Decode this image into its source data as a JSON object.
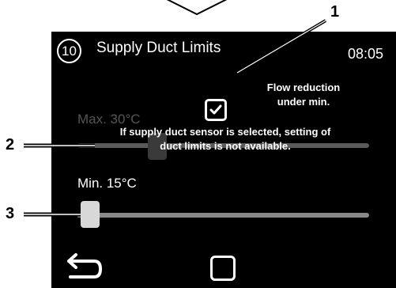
{
  "screen": {
    "menu_number": "10",
    "title": "Supply Duct Limits",
    "time": "08:05"
  },
  "flow_reduction": {
    "label": "Flow reduction\nunder min.",
    "checked": true,
    "icon": "checkmark-icon"
  },
  "max_limit": {
    "label": "Max. 30°C",
    "value_c": 30,
    "disabled": true
  },
  "warning": {
    "text": "If supply duct sensor is selected, setting of\nduct limits is not available."
  },
  "min_limit": {
    "label": "Min. 15°C",
    "value_c": 15
  },
  "nav": {
    "back_icon": "back-arrow-icon",
    "home_icon": "square-home-icon"
  },
  "callouts": {
    "one": "1",
    "two": "2",
    "three": "3"
  }
}
